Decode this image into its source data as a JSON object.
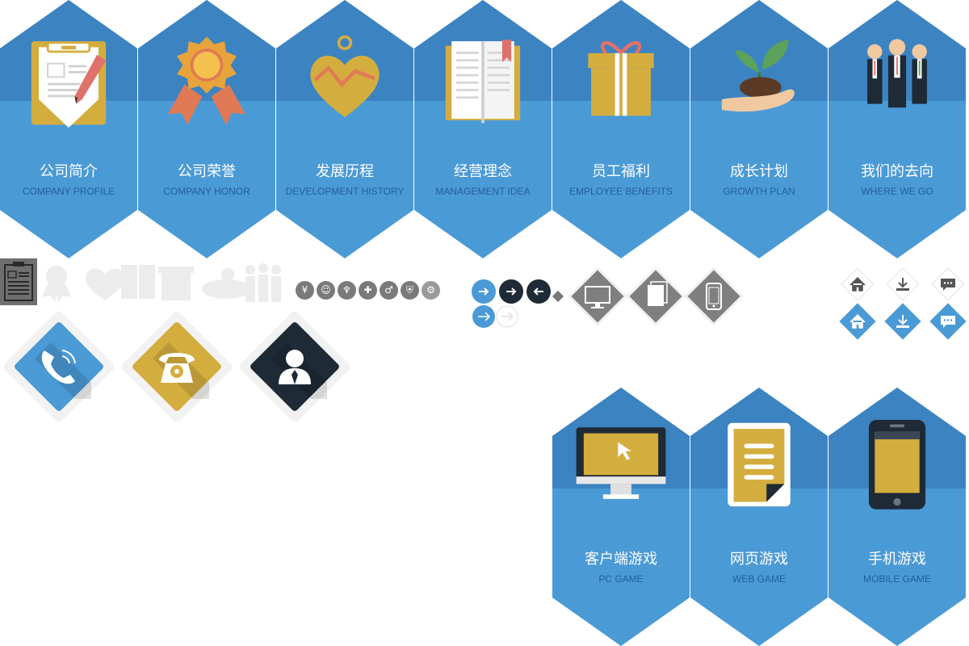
{
  "colors": {
    "blue": "#4a9ad6",
    "blue_dark": "#3c83c2",
    "shadow": "#2f6aa3",
    "gold": "#d4ad3f",
    "dark": "#1e2a36",
    "grey": "#7a7a7a",
    "light_grey": "#f2f2f2"
  },
  "hexagons": [
    {
      "zh": "公司简介",
      "en": "COMPANY PROFILE",
      "icon": "clipboard-icon"
    },
    {
      "zh": "公司荣誉",
      "en": "COMPANY HONOR",
      "icon": "award-medal-icon"
    },
    {
      "zh": "发展历程",
      "en": "DEVELOPMENT HISTORY",
      "icon": "heart-chart-icon"
    },
    {
      "zh": "经营理念",
      "en": "MANAGEMENT IDEA",
      "icon": "open-book-icon"
    },
    {
      "zh": "员工福利",
      "en": "EMPLOYEE BENEFITS",
      "icon": "gift-box-icon"
    },
    {
      "zh": "成长计划",
      "en": "GROWTH PLAN",
      "icon": "seedling-hand-icon"
    },
    {
      "zh": "我们的去向",
      "en": "WHERE WE GO",
      "icon": "team-people-icon"
    }
  ],
  "games": [
    {
      "zh": "客户端游戏",
      "en": "PC GAME",
      "icon": "desktop-monitor-icon"
    },
    {
      "zh": "网页游戏",
      "en": "WEB GAME",
      "icon": "web-page-icon"
    },
    {
      "zh": "手机游戏",
      "en": "MOBILE GAME",
      "icon": "mobile-phone-icon"
    }
  ],
  "small_circle_icons": [
    "yen-icon",
    "user-icon",
    "trophy-icon",
    "medical-bag-icon",
    "gender-icon",
    "shield-icon",
    "gear-icon"
  ],
  "contact_diamonds": [
    "phone-call-icon",
    "telephone-icon",
    "person-tie-icon"
  ],
  "device_diamonds": [
    "desktop-icon",
    "documents-icon",
    "smartphone-icon"
  ],
  "nav_icons": [
    "home-icon",
    "download-icon",
    "chat-icon"
  ]
}
